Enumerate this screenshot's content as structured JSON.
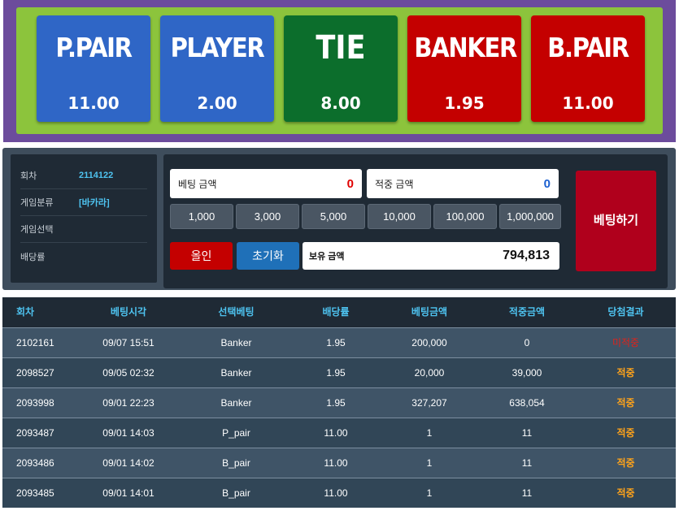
{
  "bet_options": [
    {
      "name": "P.PAIR",
      "odds": "11.00",
      "color": "#2f66c6"
    },
    {
      "name": "PLAYER",
      "odds": "2.00",
      "color": "#2f66c6"
    },
    {
      "name": "TIE",
      "odds": "8.00",
      "color": "#0c6e2c"
    },
    {
      "name": "BANKER",
      "odds": "1.95",
      "color": "#c40000"
    },
    {
      "name": "B.PAIR",
      "odds": "11.00",
      "color": "#c40000"
    }
  ],
  "info": {
    "round_label": "회차",
    "round_value": "2114122",
    "game_type_label": "게임분류",
    "game_type_value": "[바카라]",
    "game_select_label": "게임선택",
    "game_select_value": "",
    "odds_label": "배당률",
    "odds_value": ""
  },
  "form": {
    "bet_amount_label": "베팅 금액",
    "bet_amount_value": "0",
    "win_amount_label": "적중 금액",
    "win_amount_value": "0",
    "chips": [
      "1,000",
      "3,000",
      "5,000",
      "10,000",
      "100,000",
      "1,000,000"
    ],
    "allin_label": "올인",
    "reset_label": "초기화",
    "balance_label": "보유 금액",
    "balance_value": "794,813",
    "bet_button_label": "베팅하기"
  },
  "history": {
    "headers": [
      "회차",
      "베팅시각",
      "선택베팅",
      "배당률",
      "베팅금액",
      "적중금액",
      "당첨결과"
    ],
    "rows": [
      [
        "2102161",
        "09/07 15:51",
        "Banker",
        "1.95",
        "200,000",
        "0",
        "미적중"
      ],
      [
        "2098527",
        "09/05 02:32",
        "Banker",
        "1.95",
        "20,000",
        "39,000",
        "적중"
      ],
      [
        "2093998",
        "09/01 22:23",
        "Banker",
        "1.95",
        "327,207",
        "638,054",
        "적중"
      ],
      [
        "2093487",
        "09/01 14:03",
        "P_pair",
        "11.00",
        "1",
        "11",
        "적중"
      ],
      [
        "2093486",
        "09/01 14:02",
        "B_pair",
        "11.00",
        "1",
        "11",
        "적중"
      ],
      [
        "2093485",
        "09/01 14:01",
        "B_pair",
        "11.00",
        "1",
        "11",
        "적중"
      ]
    ]
  },
  "colors": {
    "accent_blue": "#4ec3f0",
    "win": "#ffa31a",
    "lose": "#e0221a",
    "board_bg": "#6c4c9c",
    "board_inner": "#8cc43c"
  }
}
